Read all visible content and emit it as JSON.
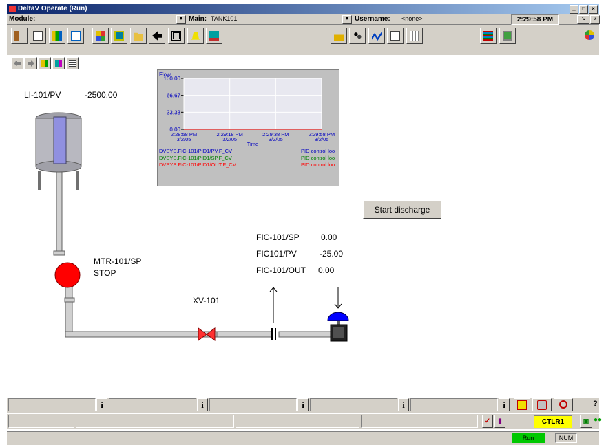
{
  "window": {
    "title": "DeltaV Operate (Run)",
    "controls": [
      "_",
      "□",
      "×"
    ]
  },
  "menubar": {
    "module_label": "Module:",
    "module_value": "",
    "main_label": "Main:",
    "main_value": "TANK101",
    "username_label": "Username:",
    "username_value": "<none>",
    "clock": "2:29:58 PM",
    "help": "?"
  },
  "toolbar": {
    "icons": [
      "exit-icon",
      "print-icon",
      "bar-display-icon",
      "select-picture-icon",
      "faceplate-icon",
      "detail-icon",
      "open-folder-icon",
      "back-icon",
      "full-screen-icon",
      "alarm-bell-icon",
      "main-display-icon",
      "acknowledge-icon",
      "user-login-icon",
      "trend-icon",
      "process-history-icon",
      "chart-icon",
      "alarm-list-icon",
      "diagnostics-icon",
      "system-icon"
    ],
    "nav_icons": [
      "arrow-left-icon",
      "arrow-right-icon",
      "layout-1-icon",
      "layout-2-icon",
      "layout-3-icon"
    ]
  },
  "process": {
    "level_tag": "LI-101/PV",
    "level_value": "-2500.00",
    "motor_tag": "MTR-101/SP",
    "motor_state": "STOP",
    "valve_tag": "XV-101",
    "fic_sp_tag": "FIC-101/SP",
    "fic_sp_value": "0.00",
    "fic_pv_tag": "FIC101/PV",
    "fic_pv_value": "-25.00",
    "fic_out_tag": "FIC-101/OUT",
    "fic_out_value": "0.00",
    "start_button": "Start discharge"
  },
  "chart_data": {
    "type": "line",
    "title": "",
    "ylabel": "Flow",
    "xlabel": "Time",
    "ylim": [
      0,
      100
    ],
    "y_ticks": [
      "100.00",
      "66.67",
      "33.33",
      "0.00"
    ],
    "x_ticks": [
      {
        "time": "2:28:58 PM",
        "date": "3/2/05"
      },
      {
        "time": "2:29:18 PM",
        "date": "3/2/05"
      },
      {
        "time": "2:29:38 PM",
        "date": "3/2/05"
      },
      {
        "time": "2:29:58 PM",
        "date": "3/2/05"
      }
    ],
    "grid": true,
    "series": [
      {
        "name": "DVSYS.FIC-101/PID1/PV.F_CV",
        "desc": "PID control loo",
        "color": "#0000c0",
        "values": [
          0,
          0,
          0,
          0
        ]
      },
      {
        "name": "DVSYS.FIC-101/PID1/SP.F_CV",
        "desc": "PID control loo",
        "color": "#008000",
        "values": [
          0,
          0,
          0,
          0
        ]
      },
      {
        "name": "DVSYS.FIC-101/PID1/OUT.F_CV",
        "desc": "PID control loo",
        "color": "#ff0000",
        "values": [
          0,
          0,
          0,
          0
        ]
      }
    ]
  },
  "status": {
    "info_label": "i",
    "controller": "CTLR1",
    "run": "Run",
    "num": "NUM",
    "help": "?"
  },
  "colors": {
    "window_bg": "#d4d0c8",
    "title_bar": "#0a246a",
    "motor_stopped": "#ff0000",
    "valve": "#ff0000",
    "actuator": "#0000ff",
    "controller_bg": "#ffff00",
    "run_bg": "#00c800"
  }
}
